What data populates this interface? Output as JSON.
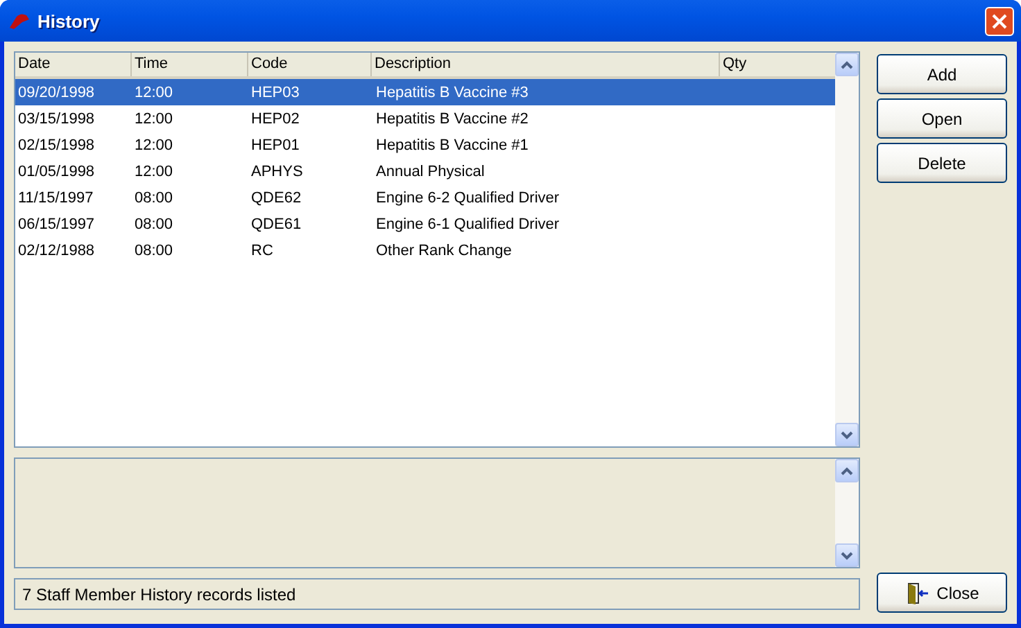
{
  "window": {
    "title": "History"
  },
  "table": {
    "columns": [
      "Date",
      "Time",
      "Code",
      "Description",
      "Qty"
    ],
    "rows": [
      {
        "cells": [
          "09/20/1998",
          "12:00",
          "HEP03",
          "Hepatitis B Vaccine #3"
        ],
        "selected": true
      },
      {
        "cells": [
          "03/15/1998",
          "12:00",
          "HEP02",
          "Hepatitis B Vaccine #2"
        ],
        "selected": false
      },
      {
        "cells": [
          "02/15/1998",
          "12:00",
          "HEP01",
          "Hepatitis B Vaccine #1"
        ],
        "selected": false
      },
      {
        "cells": [
          "01/05/1998",
          "12:00",
          "APHYS",
          "Annual Physical"
        ],
        "selected": false
      },
      {
        "cells": [
          "11/15/1997",
          "08:00",
          "QDE62",
          "Engine 6-2 Qualified Driver"
        ],
        "selected": false
      },
      {
        "cells": [
          "06/15/1997",
          "08:00",
          "QDE61",
          "Engine 6-1 Qualified Driver"
        ],
        "selected": false
      },
      {
        "cells": [
          "02/12/1988",
          "08:00",
          "RC",
          "Other Rank Change"
        ],
        "selected": false
      }
    ]
  },
  "buttons": [
    {
      "label": "Add"
    },
    {
      "label": "Open"
    },
    {
      "label": "Delete"
    }
  ],
  "status_bar": "7 Staff Member History records listed",
  "close_button": {
    "label": "Close"
  }
}
